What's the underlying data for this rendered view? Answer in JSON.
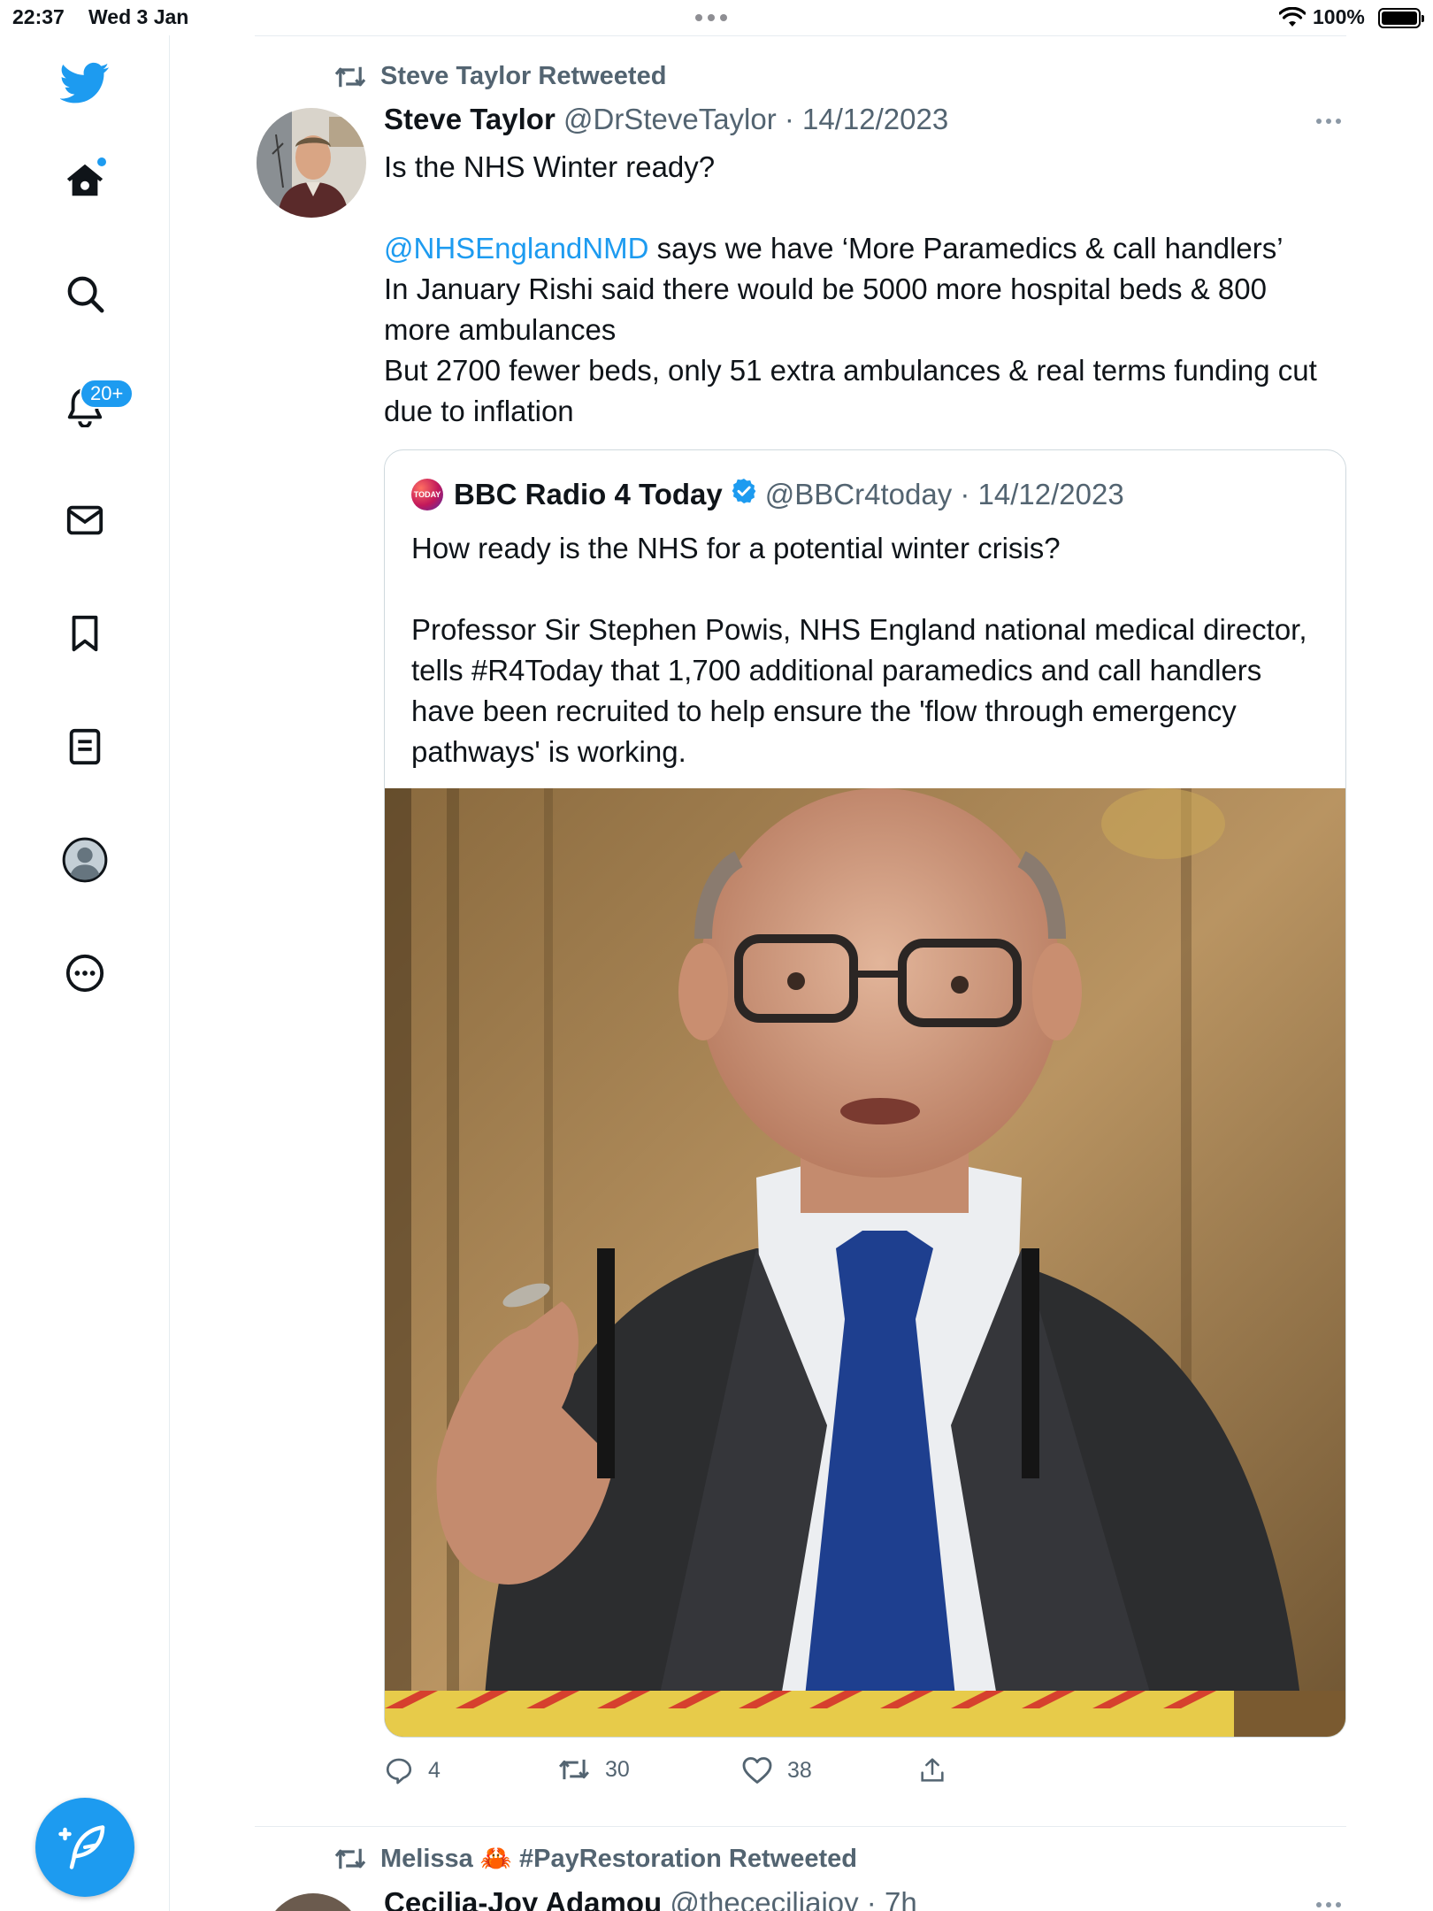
{
  "status_bar": {
    "time": "22:37",
    "date": "Wed 3 Jan",
    "battery": "100%"
  },
  "sidebar": {
    "items": [
      {
        "icon": "twitter-bird-icon"
      },
      {
        "icon": "home-icon"
      },
      {
        "icon": "search-icon"
      },
      {
        "icon": "bell-icon",
        "badge": "20+"
      },
      {
        "icon": "mail-icon"
      },
      {
        "icon": "bookmark-icon"
      },
      {
        "icon": "list-icon"
      },
      {
        "icon": "profile-icon"
      },
      {
        "icon": "more-circle-icon"
      }
    ],
    "compose_icon": "compose-feather-icon"
  },
  "tweet": {
    "retweet_label": "Steve Taylor Retweeted",
    "name": "Steve Taylor",
    "meta": "@DrSteveTaylor · 14/12/2023",
    "text_line1": "Is the NHS Winter ready?",
    "mention": "@NHSEnglandNMD",
    "text_line2": " says we have ‘More Paramedics & call handlers’",
    "text_line3": "In January Rishi said there would be 5000 more hospital beds & 800 more ambulances",
    "text_line4": "But 2700 fewer beds, only 51 extra ambulances & real terms funding cut due to inflation",
    "quote": {
      "logo_text": "TODAY",
      "name": "BBC Radio 4 Today",
      "meta": "@BBCr4today · 14/12/2023",
      "para1": "How ready is the NHS for a potential winter crisis?",
      "para2": "Professor Sir Stephen Powis, NHS England national medical director, tells #R4Today that 1,700 additional paramedics and call handlers have been recruited to help ensure the 'flow through emergency pathways' is working."
    },
    "actions": {
      "replies": "4",
      "retweets": "30",
      "likes": "38"
    }
  },
  "next_tweet": {
    "retweet_label": "Melissa 🦀 #PayRestoration Retweeted",
    "name": "Cecilia-Joy Adamou",
    "meta": "@thececiliajoy · 7h"
  },
  "colors": {
    "accent": "#1d9bf0",
    "secondary_text": "#536471",
    "border": "#cfd9de"
  }
}
